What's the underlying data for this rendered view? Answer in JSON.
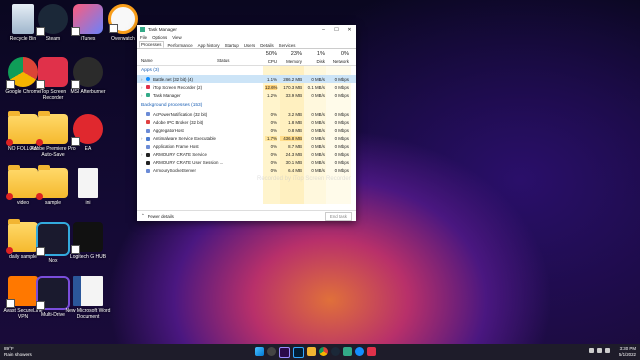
{
  "desktop": {
    "icons": [
      {
        "label": "Recycle Bin"
      },
      {
        "label": "Steam"
      },
      {
        "label": "iTunes"
      },
      {
        "label": "Overwatch"
      },
      {
        "label": "Google Chrome"
      },
      {
        "label": "iTop Screen Recorder"
      },
      {
        "label": "MSI Afterburner"
      },
      {
        "label": "NO FOLLOW"
      },
      {
        "label": "Adobe Premiere Pro Auto-Save"
      },
      {
        "label": "EA"
      },
      {
        "label": "video"
      },
      {
        "label": "sample"
      },
      {
        "label": "ini"
      },
      {
        "label": "daily sample"
      },
      {
        "label": "Nox"
      },
      {
        "label": "Logitech G HUB"
      },
      {
        "label": "Avast SecureLine VPN"
      },
      {
        "label": "Multi-Drive"
      },
      {
        "label": "New Microsoft Word Document"
      }
    ]
  },
  "taskmanager": {
    "title": "Task Manager",
    "menu": [
      "File",
      "Options",
      "View"
    ],
    "tabs": [
      "Processes",
      "Performance",
      "App history",
      "Startup",
      "Users",
      "Details",
      "Services"
    ],
    "headers": {
      "name": "Name",
      "status": "Status",
      "cpu_pct": "50%",
      "cpu": "CPU",
      "mem_pct": "23%",
      "mem": "Memory",
      "disk_pct": "1%",
      "disk": "Disk",
      "net_pct": "0%",
      "net": "Network"
    },
    "apps_section": "Apps (3)",
    "apps": [
      {
        "name": "Battle.net (32 bit) (4)",
        "cpu": "1.1%",
        "mem": "286.2 MB",
        "disk": "0 MB/s",
        "net": "0 Mbps"
      },
      {
        "name": "iTop Screen Recorder (2)",
        "cpu": "12.6%",
        "mem": "170.3 MB",
        "disk": "0.1 MB/s",
        "net": "0 Mbps"
      },
      {
        "name": "Task Manager",
        "cpu": "1.2%",
        "mem": "33.9 MB",
        "disk": "0 MB/s",
        "net": "0 Mbps"
      }
    ],
    "bg_section": "Background processes (153)",
    "bg": [
      {
        "name": "AcPowerNotification (32 bit)",
        "cpu": "0%",
        "mem": "3.2 MB",
        "disk": "0 MB/s",
        "net": "0 Mbps"
      },
      {
        "name": "Adobe IPC Broker (32 bit)",
        "cpu": "0%",
        "mem": "1.8 MB",
        "disk": "0 MB/s",
        "net": "0 Mbps"
      },
      {
        "name": "AggregatorHost",
        "cpu": "0%",
        "mem": "0.8 MB",
        "disk": "0 MB/s",
        "net": "0 Mbps"
      },
      {
        "name": "Antimalware Service Executable",
        "cpu": "1.7%",
        "mem": "436.8 MB",
        "disk": "0 MB/s",
        "net": "0 Mbps"
      },
      {
        "name": "Application Frame Host",
        "cpu": "0%",
        "mem": "8.7 MB",
        "disk": "0 MB/s",
        "net": "0 Mbps"
      },
      {
        "name": "ARMOURY CRATE Service",
        "cpu": "0%",
        "mem": "24.3 MB",
        "disk": "0 MB/s",
        "net": "0 Mbps"
      },
      {
        "name": "ARMOURY CRATE User Session ...",
        "cpu": "0%",
        "mem": "30.1 MB",
        "disk": "0 MB/s",
        "net": "0 Mbps"
      },
      {
        "name": "ArmourySocketServer",
        "cpu": "0%",
        "mem": "6.4 MB",
        "disk": "0 MB/s",
        "net": "0 Mbps"
      }
    ],
    "fewer_details": "Fewer details",
    "end_task": "End task"
  },
  "watermark": "Recorded by iTop Screen Recorder",
  "taskbar": {
    "weather_temp": "89°F",
    "weather_desc": "Rain showers",
    "time": "3:30 PM",
    "date": "5/1/2022"
  }
}
